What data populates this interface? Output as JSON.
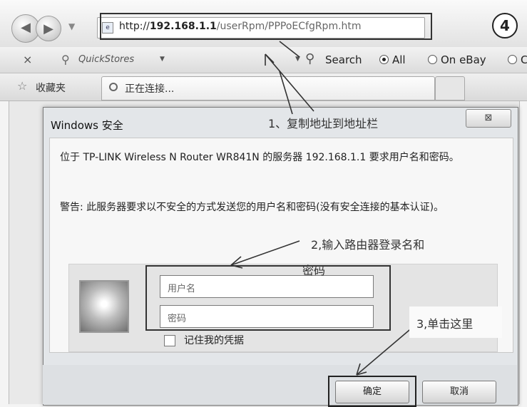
{
  "browser": {
    "address": {
      "favicon": "page-icon",
      "url_prefix": "http://",
      "url_host": "192.168.1.1",
      "url_path": "/userRpm/PPPoECfgRpm.htm"
    },
    "step_badge": "4",
    "toolbar": {
      "close": "×",
      "quickstores_icon": "magnifier-icon",
      "quickstores_label": "QuickStores",
      "dropdown": "▼",
      "search_icon": "search-icon",
      "search_label": "Search",
      "options": [
        {
          "label": "All",
          "selected": true
        },
        {
          "label": "On eBay",
          "selected": false
        },
        {
          "label": "C",
          "selected": false
        }
      ]
    },
    "favorites_label": "收藏夹",
    "tab_title": "正在连接..."
  },
  "dialog": {
    "title": "Windows 安全",
    "close_label": "⊠",
    "description": "位于 TP-LINK Wireless N Router WR841N 的服务器 192.168.1.1 要求用户名和密码。",
    "warning": "警告: 此服务器要求以不安全的方式发送您的用户名和密码(没有安全连接的基本认证)。",
    "username_placeholder": "用户名",
    "password_placeholder": "密码",
    "remember_label": "记住我的凭据",
    "remember_checked": false,
    "ok_label": "确定",
    "cancel_label": "取消"
  },
  "annotations": {
    "step1": "1、复制地址到地址栏",
    "step2": "2,输入路由器登录名和",
    "step2_cont": "密码",
    "step3": "3,单击这里"
  }
}
